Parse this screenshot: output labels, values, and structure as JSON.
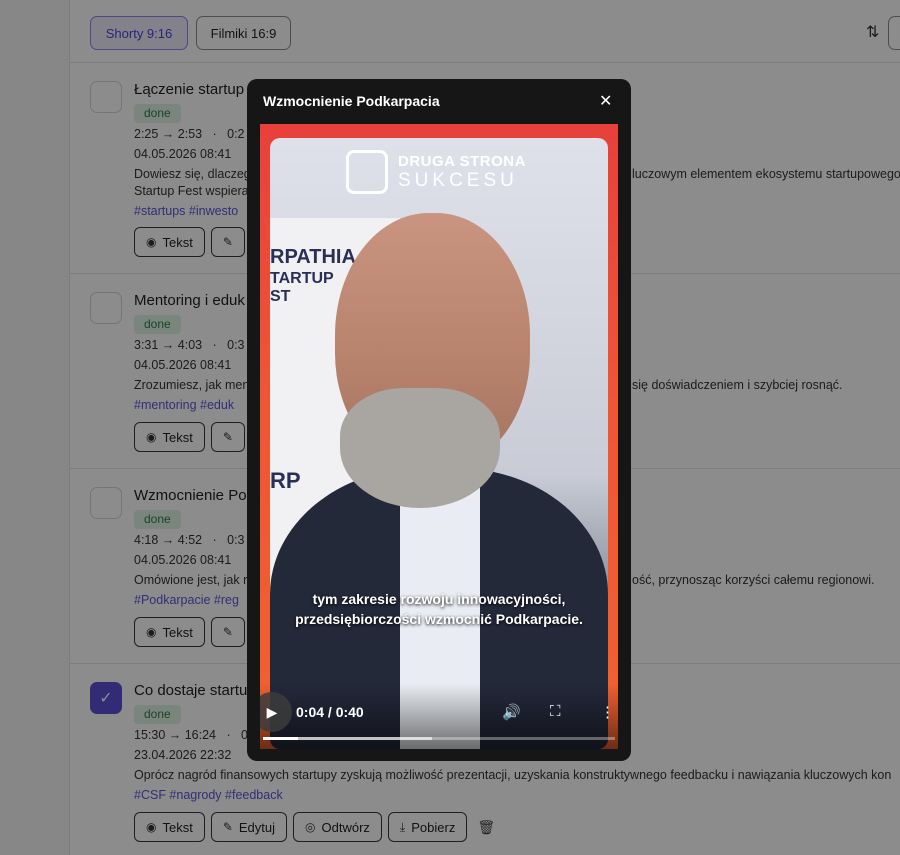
{
  "tabs": {
    "shorts": "Shorty 9:16",
    "films": "Filmiki 16:9"
  },
  "sort_icon": "⇅",
  "rows": [
    {
      "title": "Łączenie startup",
      "status": "done",
      "time": "2:25 → 2:53",
      "sep": "·",
      "dur": "0:2",
      "date": "04.05.2026 08:41",
      "desc1": "Dowiesz się, dlaczeg",
      "desc1_tail": "luczowym elementem ekosystemu startupowego.",
      "desc2": "Startup Fest wspiera",
      "tags": "#startups #inwesto",
      "checked": false
    },
    {
      "title": "Mentoring i eduk",
      "status": "done",
      "time": "3:31 → 4:03",
      "sep": "·",
      "dur": "0:3",
      "date": "04.05.2026 08:41",
      "desc1": "Zrozumiesz, jak men",
      "desc1_tail": "się doświadczeniem i szybciej rosnąć.",
      "desc2": "",
      "tags": "#mentoring #eduk",
      "checked": false
    },
    {
      "title": "Wzmocnienie Po",
      "status": "done",
      "time": "4:18 → 4:52",
      "sep": "·",
      "dur": "0:3",
      "date": "04.05.2026 08:41",
      "desc1": "Omówione jest, jak r",
      "desc1_tail": "ość, przynosząc korzyści całemu regionowi.",
      "desc2": "",
      "tags": "#Podkarpacie #reg",
      "checked": false
    },
    {
      "title": "Co dostaje startu",
      "status": "done",
      "time": "15:30 → 16:24",
      "sep": "·",
      "dur": "0",
      "date": "23.04.2026 22:32",
      "desc1": "Oprócz nagród finansowych startupy zyskują możliwość prezentacji, uzyskania konstruktywnego feedbacku i nawiązania kluczowych kon",
      "desc1_tail": "",
      "desc2": "",
      "tags": "#CSF #nagrody #feedback",
      "checked": true
    }
  ],
  "actions": {
    "text": "Tekst",
    "edit": "Edytuj",
    "play": "Odtwórz",
    "download": "Pobierz"
  },
  "icons": {
    "eye": "eye-icon",
    "pencil": "pencil-icon",
    "play": "play-circle-icon",
    "download": "download-icon",
    "trash": "trash-icon"
  },
  "modal": {
    "title": "Wzmocnienie Podkarpacia",
    "close": "✕",
    "logo_line1": "DRUGA STRONA",
    "logo_line2": "SUKCESU",
    "logo_mark": "2",
    "bg_text1": "RPATHIA",
    "bg_text2": "TARTUP",
    "bg_text3": "ST",
    "bg_text4": "RP",
    "subtitle_line1": "tym zakresie rozwoju innowacyjności,",
    "subtitle_line2": "przedsiębiorczości wzmocnić Podkarpacie.",
    "time_display": "0:04 / 0:40",
    "progress": 0.1,
    "buffered": 0.48
  },
  "colors": {
    "accent": "#5b4fd8",
    "badge_bg": "#dff3e5",
    "badge_text": "#2f7d46",
    "tag": "#5a55d8",
    "video_border": "#e8403a"
  }
}
